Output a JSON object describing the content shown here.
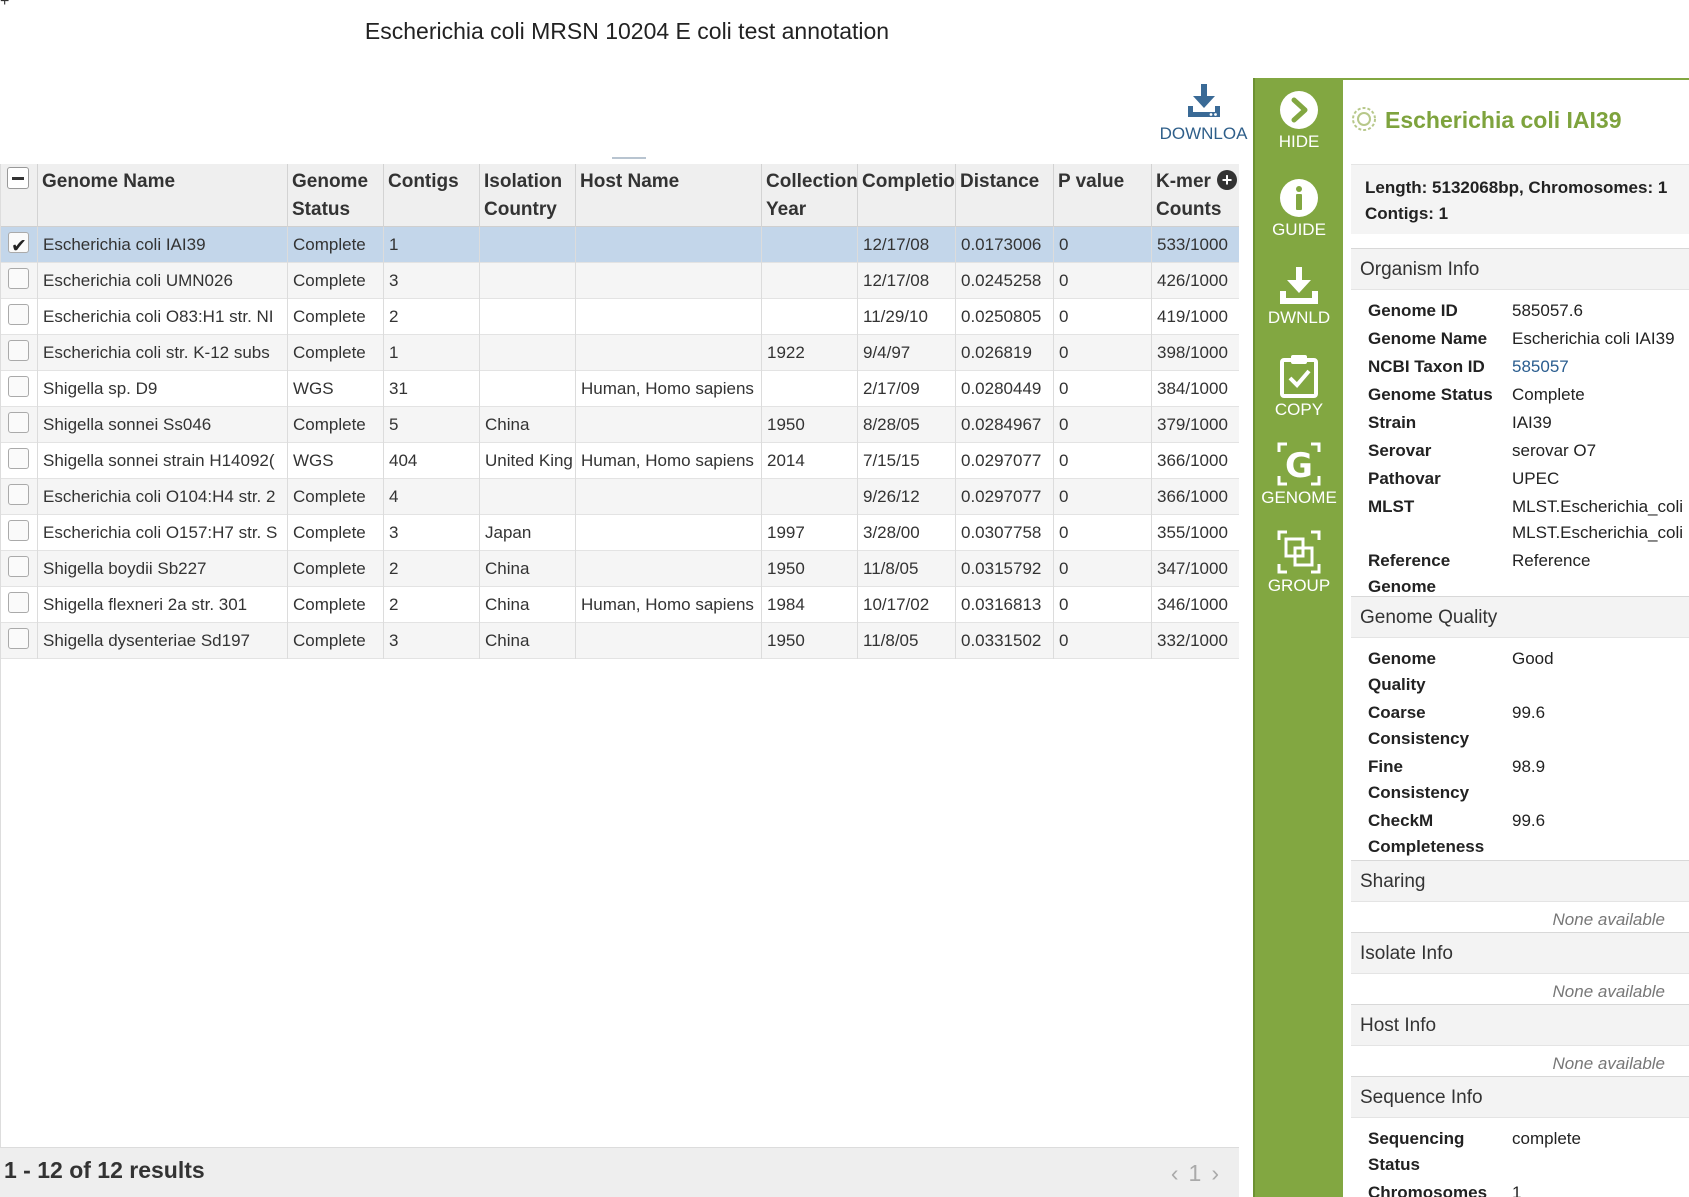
{
  "corner_glyph": "+",
  "page_title": "Escherichia coli MRSN 10204 E coli test annotation",
  "download_label": "DOWNLOA",
  "columns": [
    "Genome Name",
    "Genome Status",
    "Contigs",
    "Isolation Country",
    "Host Name",
    "Collection Year",
    "Completion Date",
    "Distance",
    "P value",
    "K-mer Counts"
  ],
  "rows": [
    {
      "checked": true,
      "name": "Escherichia coli IAI39",
      "status": "Complete",
      "contigs": "1",
      "country": "",
      "host": "",
      "year": "",
      "date": "12/17/08",
      "distance": "0.0173006",
      "p": "0",
      "kmer": "533/1000"
    },
    {
      "checked": false,
      "name": "Escherichia coli UMN026",
      "status": "Complete",
      "contigs": "3",
      "country": "",
      "host": "",
      "year": "",
      "date": "12/17/08",
      "distance": "0.0245258",
      "p": "0",
      "kmer": "426/1000"
    },
    {
      "checked": false,
      "name": "Escherichia coli O83:H1 str. NI",
      "status": "Complete",
      "contigs": "2",
      "country": "",
      "host": "",
      "year": "",
      "date": "11/29/10",
      "distance": "0.0250805",
      "p": "0",
      "kmer": "419/1000"
    },
    {
      "checked": false,
      "name": "Escherichia coli str. K-12 subs",
      "status": "Complete",
      "contigs": "1",
      "country": "",
      "host": "",
      "year": "1922",
      "date": "9/4/97",
      "distance": "0.026819",
      "p": "0",
      "kmer": "398/1000"
    },
    {
      "checked": false,
      "name": "Shigella sp. D9",
      "status": "WGS",
      "contigs": "31",
      "country": "",
      "host": "Human, Homo sapiens",
      "year": "",
      "date": "2/17/09",
      "distance": "0.0280449",
      "p": "0",
      "kmer": "384/1000"
    },
    {
      "checked": false,
      "name": "Shigella sonnei Ss046",
      "status": "Complete",
      "contigs": "5",
      "country": "China",
      "host": "",
      "year": "1950",
      "date": "8/28/05",
      "distance": "0.0284967",
      "p": "0",
      "kmer": "379/1000"
    },
    {
      "checked": false,
      "name": "Shigella sonnei strain H14092(",
      "status": "WGS",
      "contigs": "404",
      "country": "United King",
      "host": "Human, Homo sapiens",
      "year": "2014",
      "date": "7/15/15",
      "distance": "0.0297077",
      "p": "0",
      "kmer": "366/1000"
    },
    {
      "checked": false,
      "name": "Escherichia coli O104:H4 str. 2",
      "status": "Complete",
      "contigs": "4",
      "country": "",
      "host": "",
      "year": "",
      "date": "9/26/12",
      "distance": "0.0297077",
      "p": "0",
      "kmer": "366/1000"
    },
    {
      "checked": false,
      "name": "Escherichia coli O157:H7 str. S",
      "status": "Complete",
      "contigs": "3",
      "country": "Japan",
      "host": "",
      "year": "1997",
      "date": "3/28/00",
      "distance": "0.0307758",
      "p": "0",
      "kmer": "355/1000"
    },
    {
      "checked": false,
      "name": "Shigella boydii Sb227",
      "status": "Complete",
      "contigs": "2",
      "country": "China",
      "host": "",
      "year": "1950",
      "date": "11/8/05",
      "distance": "0.0315792",
      "p": "0",
      "kmer": "347/1000"
    },
    {
      "checked": false,
      "name": "Shigella flexneri 2a str. 301",
      "status": "Complete",
      "contigs": "2",
      "country": "China",
      "host": "Human, Homo sapiens",
      "year": "1984",
      "date": "10/17/02",
      "distance": "0.0316813",
      "p": "0",
      "kmer": "346/1000"
    },
    {
      "checked": false,
      "name": "Shigella dysenteriae Sd197",
      "status": "Complete",
      "contigs": "3",
      "country": "China",
      "host": "",
      "year": "1950",
      "date": "11/8/05",
      "distance": "0.0331502",
      "p": "0",
      "kmer": "332/1000"
    }
  ],
  "footer": {
    "results": "1 - 12 of 12 results",
    "prev": "‹",
    "page": "1",
    "next": "›"
  },
  "action_bar": [
    {
      "label": "HIDE",
      "icon": "chevron-right-circle-icon"
    },
    {
      "label": "GUIDE",
      "icon": "info-circle-icon"
    },
    {
      "label": "DWNLD",
      "icon": "download-icon"
    },
    {
      "label": "COPY",
      "icon": "clipboard-check-icon"
    },
    {
      "label": "GENOME",
      "icon": "genome-g-icon"
    },
    {
      "label": "GROUP",
      "icon": "group-squares-icon"
    }
  ],
  "panel": {
    "title": "Escherichia coli IAI39",
    "summary_line1": "Length: 5132068bp, Chromosomes: 1",
    "summary_line2": "Contigs: 1",
    "organism_info": {
      "heading": "Organism Info",
      "fields": [
        {
          "k": "Genome ID",
          "v": "585057.6"
        },
        {
          "k": "Genome Name",
          "v": "Escherichia coli IAI39"
        },
        {
          "k": "NCBI Taxon ID",
          "v": "585057"
        },
        {
          "k": "Genome Status",
          "v": "Complete"
        },
        {
          "k": "Strain",
          "v": "IAI39"
        },
        {
          "k": "Serovar",
          "v": "serovar O7"
        },
        {
          "k": "Pathovar",
          "v": "UPEC"
        },
        {
          "k": "MLST",
          "v1": "MLST.Escherichia_coli",
          "v2": "MLST.Escherichia_coli"
        },
        {
          "k1": "Reference",
          "k2": "Genome",
          "v": "Reference"
        }
      ]
    },
    "genome_quality": {
      "heading": "Genome Quality",
      "fields": [
        {
          "k1": "Genome",
          "k2": "Quality",
          "v": "Good"
        },
        {
          "k1": "Coarse",
          "k2": "Consistency",
          "v": "99.6"
        },
        {
          "k1": "Fine",
          "k2": "Consistency",
          "v": "98.9"
        },
        {
          "k1": "CheckM",
          "k2": "Completeness",
          "v": "99.6"
        }
      ]
    },
    "sharing": {
      "heading": "Sharing",
      "none": "None available"
    },
    "isolate_info": {
      "heading": "Isolate Info",
      "none": "None available"
    },
    "host_info": {
      "heading": "Host Info",
      "none": "None available"
    },
    "sequence_info": {
      "heading": "Sequence Info",
      "fields": [
        {
          "k1": "Sequencing",
          "k2": "Status",
          "v": "complete"
        },
        {
          "k": "Chromosomes",
          "v": "1"
        }
      ]
    }
  },
  "colors": {
    "accent_green": "#82a741",
    "title_green": "#7ea33d",
    "selected_row": "#c3d6ea",
    "link_blue": "#2a5d8f"
  }
}
